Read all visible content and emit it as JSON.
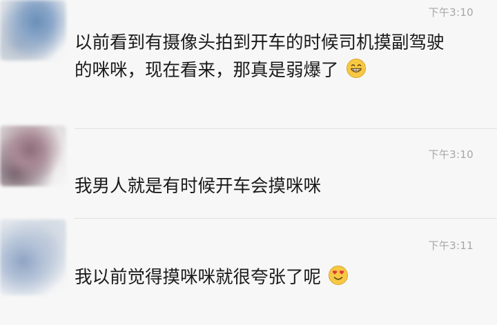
{
  "messages": [
    {
      "time": "下午3:10",
      "text": "以前看到有摄像头拍到开车的时候司机摸副驾驶的咪咪，现在看来，那真是弱爆了",
      "emoji": "grinning-face-emoji"
    },
    {
      "time": "下午3:10",
      "text": "我男人就是有时候开车会摸咪咪"
    },
    {
      "time": "下午3:11",
      "text": "我以前觉得摸咪咪就很夸张了呢",
      "emoji": "heart-eyes-face-emoji"
    }
  ],
  "colors": {
    "background": "#f7f7f7",
    "text": "#1a1a1a",
    "timestamp": "#a6a6a6",
    "divider": "#e1e1e1",
    "emoji_face": "#f7c843"
  }
}
